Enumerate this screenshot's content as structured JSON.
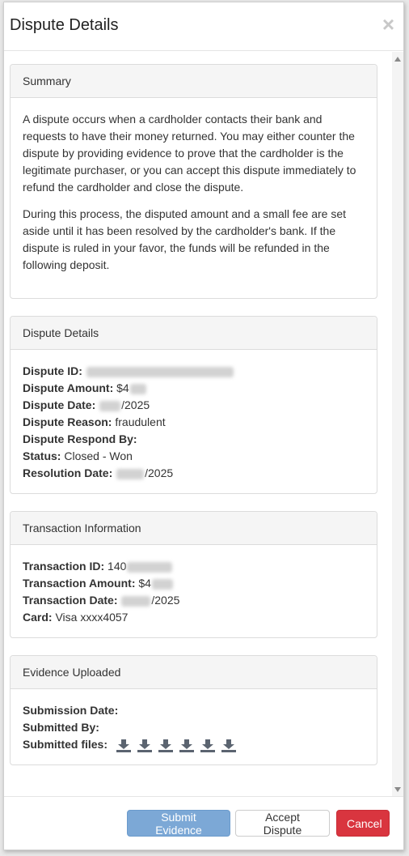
{
  "modal": {
    "title": "Dispute Details",
    "close_symbol": "×"
  },
  "summary": {
    "heading": "Summary",
    "paragraphs": [
      "A dispute occurs when a cardholder contacts their bank and requests to have their money returned. You may either counter the dispute by providing evidence to prove that the cardholder is the legitimate purchaser, or you can accept this dispute immediately to refund the cardholder and close the dispute.",
      "During this process, the disputed amount and a small fee are set aside until it has been resolved by the cardholder's bank. If the dispute is ruled in your favor, the funds will be refunded in the following deposit."
    ]
  },
  "dispute_details": {
    "heading": "Dispute Details",
    "id_label": "Dispute ID:",
    "id_value": "",
    "amount_label": "Dispute Amount:",
    "amount_value": "$4",
    "date_label": "Dispute Date:",
    "date_value": "/2025",
    "reason_label": "Dispute Reason:",
    "reason_value": "fraudulent",
    "respond_label": "Dispute Respond By:",
    "respond_value": "",
    "status_label": "Status:",
    "status_value": "Closed - Won",
    "resolution_label": "Resolution Date:",
    "resolution_value": "/2025"
  },
  "transaction": {
    "heading": "Transaction Information",
    "id_label": "Transaction ID:",
    "id_value": "140",
    "amount_label": "Transaction Amount:",
    "amount_value": "$4",
    "date_label": "Transaction Date:",
    "date_value": "/2025",
    "card_label": "Card:",
    "card_value": "Visa xxxx4057"
  },
  "evidence": {
    "heading": "Evidence Uploaded",
    "submission_label": "Submission Date:",
    "submitted_by_label": "Submitted By:",
    "files_label": "Submitted files:",
    "file_icons": [
      "download-icon",
      "download-icon",
      "download-icon",
      "download-icon",
      "download-icon",
      "download-icon"
    ]
  },
  "footer": {
    "submit_label": "Submit Evidence",
    "accept_label": "Accept Dispute",
    "cancel_label": "Cancel"
  },
  "colors": {
    "primary": "#7ca8d6",
    "danger": "#d9353f",
    "panel_heading_bg": "#f5f5f5",
    "icon": "#5b6470"
  }
}
